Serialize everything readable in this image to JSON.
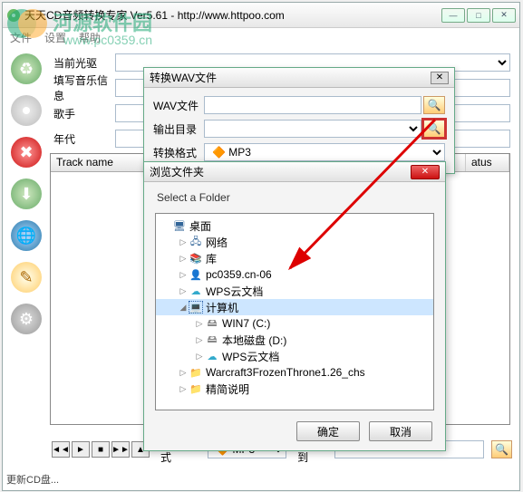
{
  "app": {
    "title": "天天CD音频转换专家 Ver5.61 - http://www.httpoo.com",
    "menu": [
      "文件",
      "设置",
      "帮助"
    ],
    "winbuttons": [
      "—",
      "□",
      "✕"
    ]
  },
  "watermark": {
    "text": "河源软件园",
    "url": "www.pc0359.cn"
  },
  "form": {
    "drive_label": "当前光驱",
    "music_label": "填写音乐信息",
    "singer_label": "歌手",
    "year_label": "年代",
    "singer_value": "",
    "year_value": ""
  },
  "tracks": {
    "col_name": "Track name",
    "col_status": "atus"
  },
  "bottom": {
    "format_label": "转换格式",
    "format_value": "MP3",
    "saveto_label": "保存到",
    "saveto_value": ""
  },
  "status": "更新CD盘...",
  "wavdlg": {
    "title": "转换WAV文件",
    "wav_label": "WAV文件",
    "wav_value": "",
    "outdir_label": "输出目录",
    "outdir_value": "",
    "format_label": "转换格式",
    "format_value": "MP3"
  },
  "folderdlg": {
    "title": "浏览文件夹",
    "prompt": "Select a Folder",
    "ok": "确定",
    "cancel": "取消",
    "tree": [
      {
        "lv": 0,
        "exp": "",
        "icon": "desktop",
        "label": "桌面"
      },
      {
        "lv": 1,
        "exp": "▷",
        "icon": "net",
        "label": "网络"
      },
      {
        "lv": 1,
        "exp": "▷",
        "icon": "lib",
        "label": "库"
      },
      {
        "lv": 1,
        "exp": "▷",
        "icon": "user",
        "label": "pc0359.cn-06"
      },
      {
        "lv": 1,
        "exp": "▷",
        "icon": "cloud",
        "label": "WPS云文档"
      },
      {
        "lv": 1,
        "exp": "◢",
        "icon": "pc",
        "label": "计算机",
        "selected": true
      },
      {
        "lv": 2,
        "exp": "▷",
        "icon": "hdd",
        "label": "WIN7 (C:)"
      },
      {
        "lv": 2,
        "exp": "▷",
        "icon": "hdd",
        "label": "本地磁盘 (D:)"
      },
      {
        "lv": 2,
        "exp": "▷",
        "icon": "cloud",
        "label": "WPS云文档"
      },
      {
        "lv": 1,
        "exp": "▷",
        "icon": "folder",
        "label": "Warcraft3FrozenThrone1.26_chs"
      },
      {
        "lv": 1,
        "exp": "▷",
        "icon": "folder",
        "label": "精简说明"
      }
    ]
  }
}
